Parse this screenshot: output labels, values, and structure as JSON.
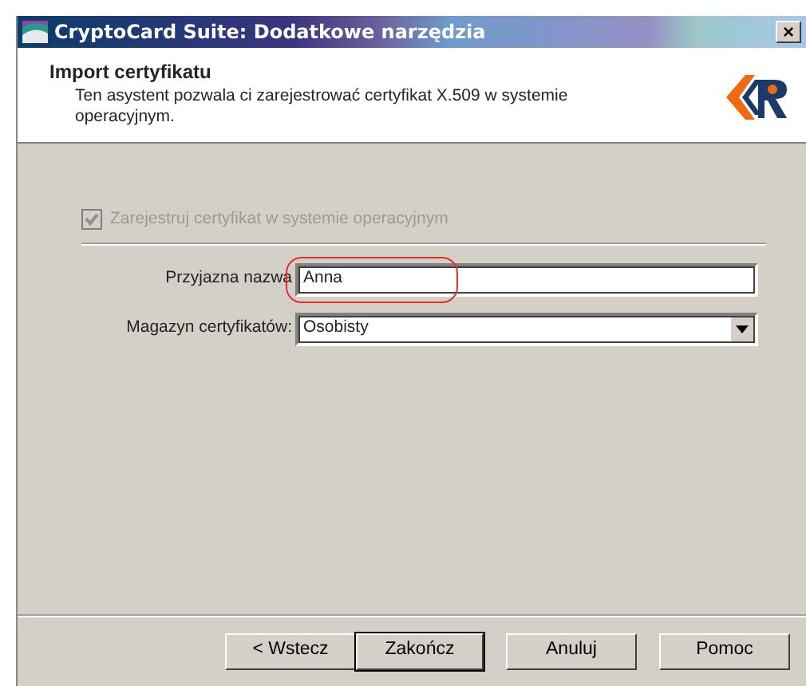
{
  "window": {
    "title": "CryptoCard Suite: Dodatkowe narzędzia",
    "close": "×"
  },
  "header": {
    "title": "Import certyfikatu",
    "description": "Ten asystent pozwala ci zarejestrować certyfikat X.509 w systemie operacyjnym."
  },
  "checkbox": {
    "label": "Zarejestruj certyfikat w systemie operacyjnym",
    "checked": true,
    "disabled": true
  },
  "fields": [
    {
      "kind": "text",
      "label": "Przyjazna nazwa",
      "value": "Anna",
      "highlighted": true
    },
    {
      "kind": "select",
      "label": "Magazyn certyfikatów:",
      "value": "Osobisty",
      "highlighted": false
    }
  ],
  "buttons": [
    {
      "label": "< Wstecz",
      "default": false
    },
    {
      "label": "Zakończ",
      "default": true
    },
    {
      "label": "Anuluj",
      "default": false
    },
    {
      "label": "Pomoc",
      "default": false
    }
  ]
}
